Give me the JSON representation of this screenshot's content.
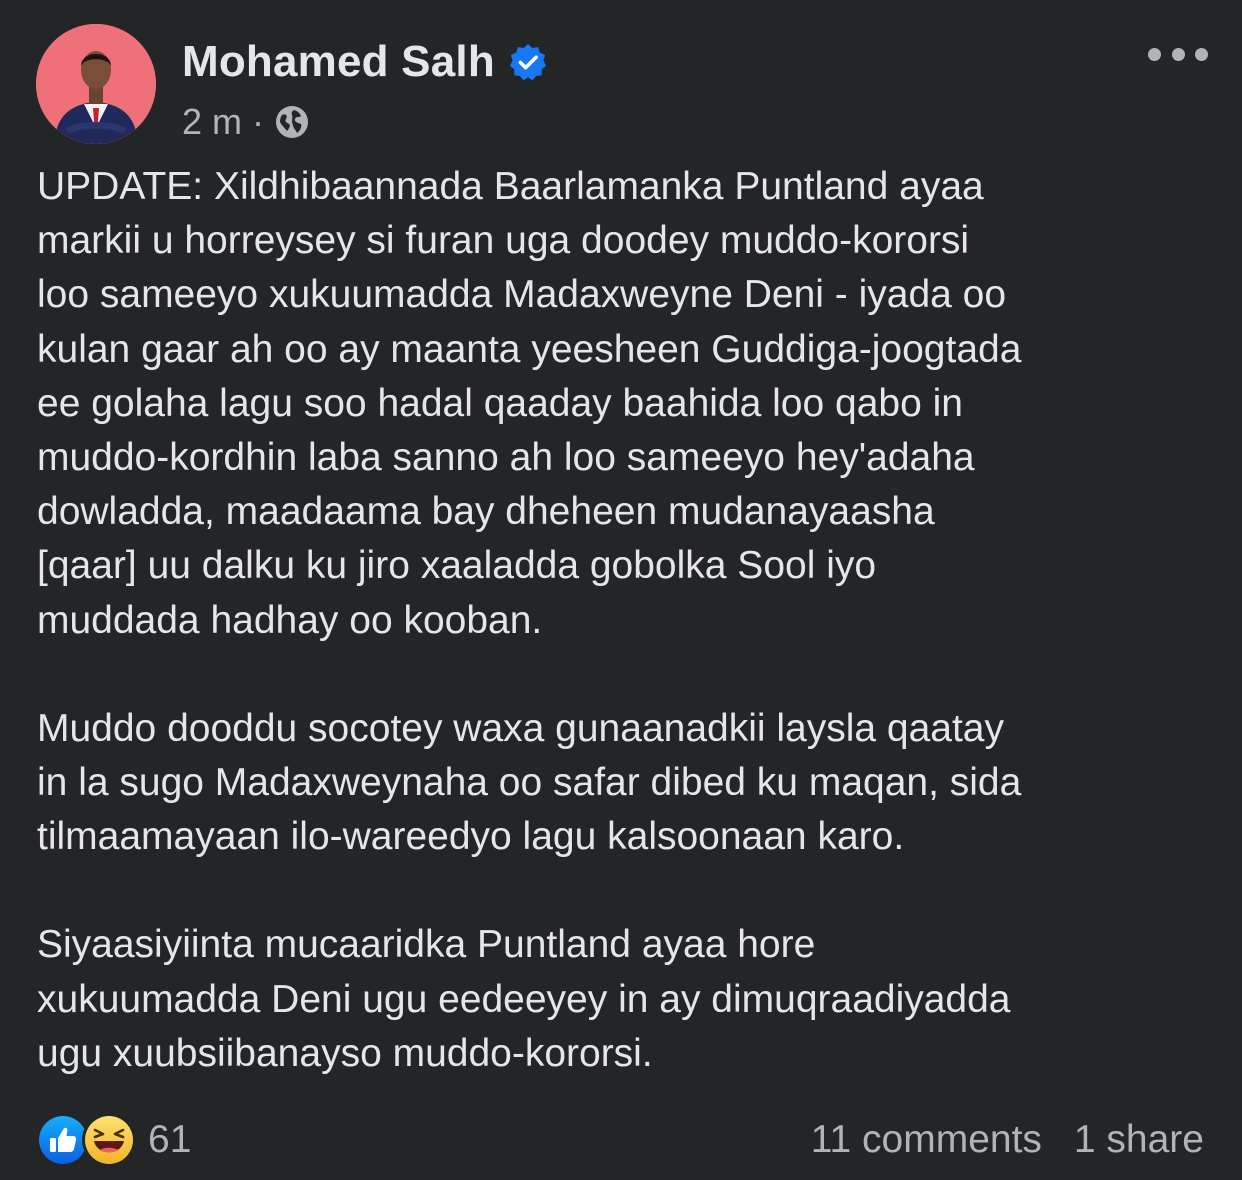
{
  "post": {
    "author": "Mohamed Salh",
    "verified_icon": "verified-badge-icon",
    "time": "2 m",
    "separator": "·",
    "audience_icon": "globe-icon",
    "more_icon": "more-options-icon",
    "paragraphs": [
      "UPDATE: Xildhibaannada Baarlamanka Puntland ayaa markii u horreysey si furan uga doodey muddo-kororsi loo sameeyo xukuumadda Madaxweyne Deni - iyada oo kulan gaar ah oo ay maanta yeesheen Guddiga-joogtada ee golaha lagu soo hadal qaaday baahida loo qabo in muddo-kordhin laba sanno ah loo sameeyo hey'adaha dowladda, maadaama bay dheheen mudanayaasha [qaar] uu dalku ku jiro xaaladda gobolka Sool iyo muddada hadhay oo kooban.",
      "Muddo dooddu socotey waxa gunaanadkii laysla qaatay in la sugo Madaxweynaha oo safar dibed ku maqan, sida tilmaamayaan ilo-wareedyo lagu kalsoonaan karo.",
      "Siyaasiyiinta mucaaridka Puntland ayaa hore xukuumadda Deni ugu eedeeyey in ay dimuqraadiyadda ugu xuubsiibanayso muddo-kororsi."
    ],
    "lines": [
      [
        "UPDATE: Xildhibaannada Baarlamanka Puntland ayaa",
        "markii u horreysey si furan uga doodey muddo-kororsi",
        "loo sameeyo xukuumadda Madaxweyne Deni - iyada oo",
        "kulan gaar ah oo ay maanta yeesheen Guddiga-joogtada",
        "ee golaha lagu soo hadal qaaday baahida loo qabo in",
        "muddo-kordhin laba sanno ah loo sameeyo hey'adaha",
        "dowladda, maadaama bay dheheen mudanayaasha",
        "[qaar] uu dalku ku jiro xaaladda gobolka Sool iyo",
        "muddada hadhay oo kooban."
      ],
      [
        "Muddo dooddu socotey waxa gunaanadkii laysla qaatay",
        "in la sugo Madaxweynaha oo safar dibed ku maqan, sida",
        "tilmaamayaan ilo-wareedyo lagu kalsoonaan karo."
      ],
      [
        "Siyaasiyiinta mucaaridka Puntland ayaa hore",
        "xukuumadda Deni ugu eedeeyey in ay dimuqraadiyadda",
        "ugu xuubsiibanayso muddo-kororsi."
      ]
    ]
  },
  "reactions": {
    "icons": [
      "like-reaction-icon",
      "haha-reaction-icon"
    ],
    "count": "61",
    "comments": "11 comments",
    "shares": "1 share"
  },
  "colors": {
    "background": "#242527",
    "text_primary": "#e4e6eb",
    "text_secondary": "#b0b3b8",
    "verified_blue": "#1877f2",
    "like_blue": "#1b74e4",
    "haha_yellow": "#f7c948",
    "avatar_bg": "#f0707a"
  }
}
